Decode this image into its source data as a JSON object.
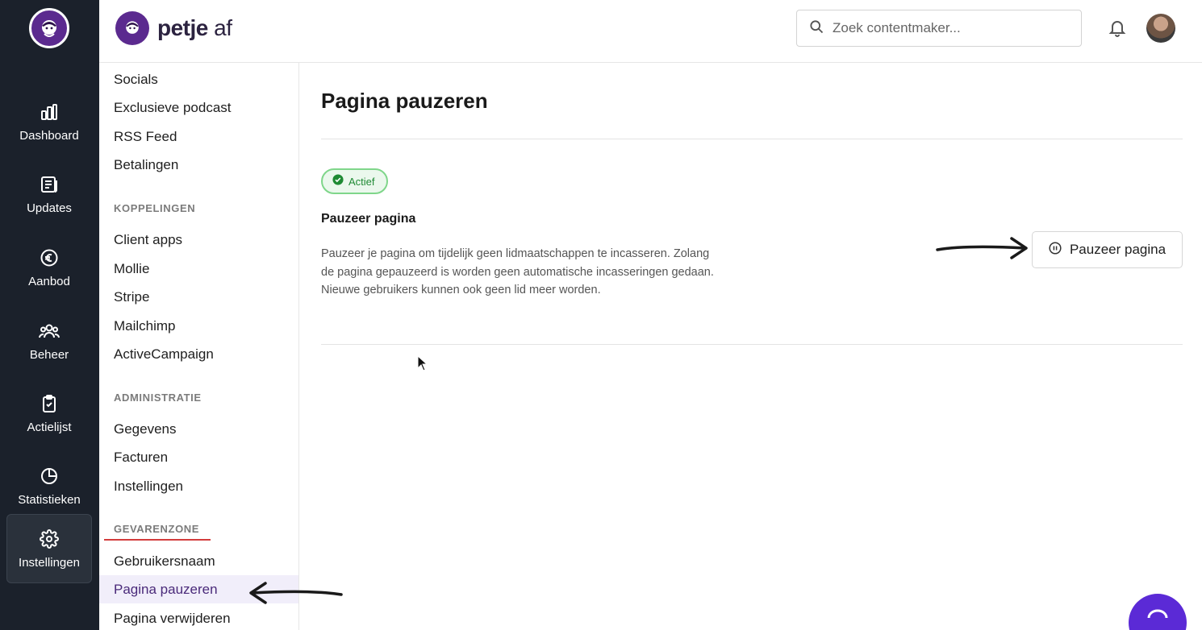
{
  "brand": {
    "name_bold": "petje",
    "name_light": "af"
  },
  "rail": {
    "items": [
      {
        "label": "Dashboard",
        "icon": "bar-chart-icon"
      },
      {
        "label": "Updates",
        "icon": "newspaper-icon"
      },
      {
        "label": "Aanbod",
        "icon": "euro-icon"
      },
      {
        "label": "Beheer",
        "icon": "users-icon"
      },
      {
        "label": "Actielijst",
        "icon": "clipboard-check-icon"
      },
      {
        "label": "Statistieken",
        "icon": "pie-chart-icon"
      },
      {
        "label": "Instellingen",
        "icon": "gear-icon",
        "active": true
      }
    ]
  },
  "header": {
    "search_placeholder": "Zoek contentmaker...",
    "bell_icon": "bell-icon",
    "avatar": "user-avatar"
  },
  "subnav": {
    "top_items": [
      "Socials",
      "Exclusieve podcast",
      "RSS Feed",
      "Betalingen"
    ],
    "koppelingen": {
      "heading": "KOPPELINGEN",
      "items": [
        "Client apps",
        "Mollie",
        "Stripe",
        "Mailchimp",
        "ActiveCampaign"
      ]
    },
    "administratie": {
      "heading": "ADMINISTRATIE",
      "items": [
        "Gegevens",
        "Facturen",
        "Instellingen"
      ]
    },
    "gevarenzone": {
      "heading": "GEVARENZONE",
      "items": [
        "Gebruikersnaam",
        "Pagina pauzeren",
        "Pagina verwijderen"
      ],
      "active": "Pagina pauzeren"
    }
  },
  "main": {
    "title": "Pagina pauzeren",
    "status_badge": "Actief",
    "section_title": "Pauzeer pagina",
    "description": "Pauzeer je pagina om tijdelijk geen lidmaatschappen te incasseren. Zolang de pagina gepauzeerd is worden geen automatische incasseringen gedaan. Nieuwe gebruikers kunnen ook geen lid meer worden.",
    "pause_button": "Pauzeer pagina"
  },
  "colors": {
    "rail_bg": "#1b212b",
    "brand_purple": "#5b2a8f",
    "active_bg": "#f1eefa",
    "badge_green": "#1f8a34",
    "chat_fab": "#5b2ad6"
  }
}
